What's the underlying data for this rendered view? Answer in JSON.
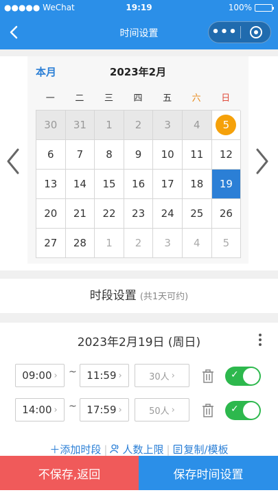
{
  "status_bar": {
    "carrier": "●●●●● WeChat",
    "time": "19:19",
    "battery": "100%"
  },
  "nav": {
    "title": "时间设置",
    "more": "•••"
  },
  "calendar": {
    "month_button": "本月",
    "title": "2023年2月",
    "weekdays": [
      "一",
      "二",
      "三",
      "四",
      "五",
      "六",
      "日"
    ],
    "days": [
      {
        "d": "30",
        "s": "past"
      },
      {
        "d": "31",
        "s": "past"
      },
      {
        "d": "1",
        "s": "past"
      },
      {
        "d": "2",
        "s": "past"
      },
      {
        "d": "3",
        "s": "past"
      },
      {
        "d": "4",
        "s": "past"
      },
      {
        "d": "5",
        "s": "today"
      },
      {
        "d": "6",
        "s": ""
      },
      {
        "d": "7",
        "s": ""
      },
      {
        "d": "8",
        "s": ""
      },
      {
        "d": "9",
        "s": ""
      },
      {
        "d": "10",
        "s": ""
      },
      {
        "d": "11",
        "s": ""
      },
      {
        "d": "12",
        "s": ""
      },
      {
        "d": "13",
        "s": ""
      },
      {
        "d": "14",
        "s": ""
      },
      {
        "d": "15",
        "s": ""
      },
      {
        "d": "16",
        "s": ""
      },
      {
        "d": "17",
        "s": ""
      },
      {
        "d": "18",
        "s": ""
      },
      {
        "d": "19",
        "s": "selected"
      },
      {
        "d": "20",
        "s": ""
      },
      {
        "d": "21",
        "s": ""
      },
      {
        "d": "22",
        "s": ""
      },
      {
        "d": "23",
        "s": ""
      },
      {
        "d": "24",
        "s": ""
      },
      {
        "d": "25",
        "s": ""
      },
      {
        "d": "26",
        "s": ""
      },
      {
        "d": "27",
        "s": ""
      },
      {
        "d": "28",
        "s": ""
      },
      {
        "d": "1",
        "s": "other"
      },
      {
        "d": "2",
        "s": "other"
      },
      {
        "d": "3",
        "s": "other"
      },
      {
        "d": "4",
        "s": "other"
      },
      {
        "d": "5",
        "s": "other"
      }
    ]
  },
  "period": {
    "title": "时段设置",
    "count": "(共1天可约)"
  },
  "slots": {
    "date": "2023年2月19日 (周日)",
    "tilde": "~",
    "chev": "›",
    "rows": [
      {
        "start": "09:00",
        "end": "11:59",
        "capacity": "30人",
        "enabled": true
      },
      {
        "start": "14:00",
        "end": "17:59",
        "capacity": "50人",
        "enabled": true
      }
    ],
    "actions": {
      "add": "＋添加时段",
      "limit": "人数上限",
      "copy": "复制/模板",
      "sep": "|"
    }
  },
  "footer": {
    "no_save": "不保存,返回",
    "save": "保存时间设置"
  },
  "colors": {
    "primary": "#2b8fe8",
    "accent_blue": "#2b7fd6",
    "danger": "#f05a5a",
    "today": "#f5a10a",
    "toggle_on": "#2db84d"
  }
}
